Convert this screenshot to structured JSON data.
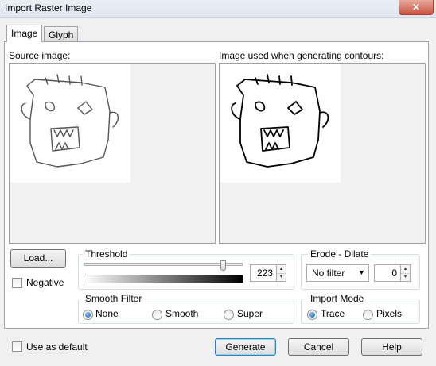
{
  "window": {
    "title": "Import Raster Image",
    "close_glyph": "✕"
  },
  "tabs": [
    {
      "label": "Image",
      "active": true
    },
    {
      "label": "Glyph",
      "active": false
    }
  ],
  "images": {
    "source_label": "Source image:",
    "contours_label": "Image used when generating contours:"
  },
  "load_button": {
    "label": "Load..."
  },
  "negative": {
    "label": "Negative",
    "checked": false
  },
  "threshold": {
    "label": "Threshold",
    "value": "223",
    "slider_fraction": 0.874
  },
  "erode_dilate": {
    "label": "Erode - Dilate",
    "filter_value": "No filter",
    "value": "0"
  },
  "smooth_filter": {
    "label": "Smooth Filter",
    "options": [
      "None",
      "Smooth",
      "Super"
    ],
    "selected": "None"
  },
  "import_mode": {
    "label": "Import Mode",
    "options": [
      "Trace",
      "Pixels"
    ],
    "selected": "Trace"
  },
  "footer": {
    "use_default_label": "Use as default",
    "use_default_checked": false,
    "generate_label": "Generate",
    "cancel_label": "Cancel",
    "help_label": "Help"
  },
  "colors": {
    "accent": "#3c7fb1",
    "radio_fill": "#1a5fb4"
  }
}
